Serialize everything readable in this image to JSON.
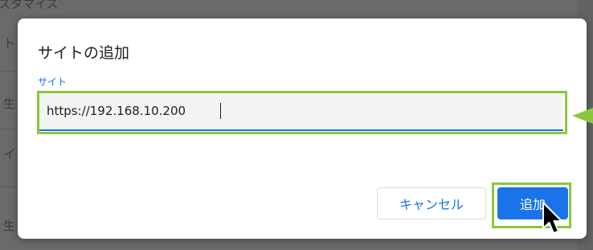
{
  "background": {
    "fragments": [
      "スタマイス",
      "ト",
      "生",
      "イ",
      "生"
    ]
  },
  "dialog": {
    "title": "サイトの追加",
    "field_label": "サイト",
    "input_value": "https://192.168.10.200",
    "cancel_label": "キャンセル",
    "add_label": "追加"
  },
  "colors": {
    "accent": "#1a73e8",
    "highlight": "#8cc63f"
  },
  "icons": {
    "cursor": "mouse-pointer-icon"
  }
}
